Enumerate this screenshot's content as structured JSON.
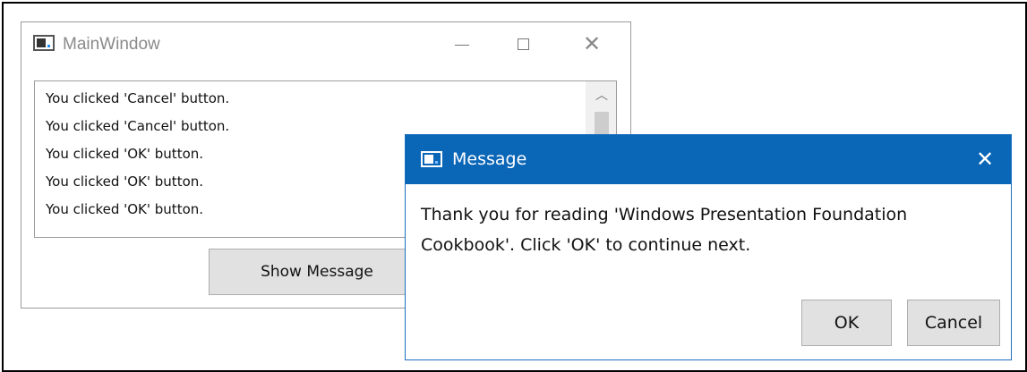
{
  "main_window": {
    "title": "MainWindow",
    "list_items": [
      "You clicked 'Cancel' button.",
      "You clicked 'Cancel' button.",
      "You clicked 'OK' button.",
      "You clicked 'OK' button.",
      "You clicked 'OK' button."
    ],
    "show_button_label": "Show Message",
    "minimize_symbol": "—",
    "maximize_symbol": "☐",
    "close_symbol": "✕"
  },
  "dialog": {
    "title": "Message",
    "message": "Thank you for reading 'Windows Presentation Foundation Cookbook'. Click 'OK' to continue next.",
    "ok_label": "OK",
    "cancel_label": "Cancel",
    "close_symbol": "✕"
  },
  "colors": {
    "dialog_titlebar": "#0a66b7",
    "button_bg": "#e1e1e1"
  },
  "icons": [
    "app-window-icon",
    "minimize-icon",
    "maximize-icon",
    "close-icon",
    "scroll-up-icon"
  ]
}
